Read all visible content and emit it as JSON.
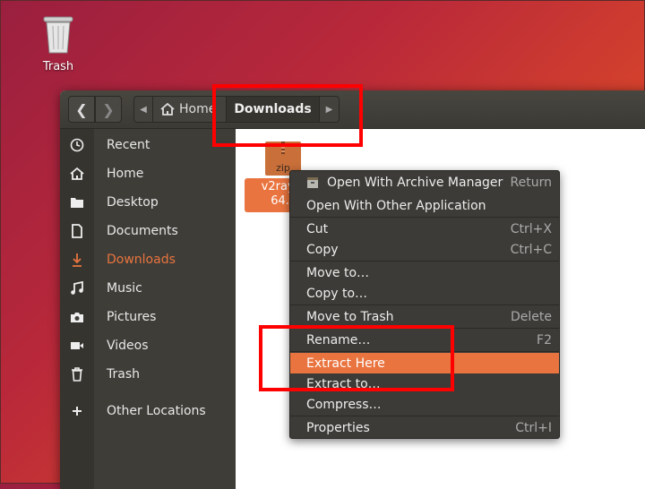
{
  "desktop": {
    "trash_label": "Trash"
  },
  "headerbar": {
    "home_label": "Home",
    "current_folder": "Downloads"
  },
  "sidebar": {
    "items": [
      {
        "label": "Recent",
        "icon": "clock-icon"
      },
      {
        "label": "Home",
        "icon": "home-icon"
      },
      {
        "label": "Desktop",
        "icon": "folder-icon"
      },
      {
        "label": "Documents",
        "icon": "document-icon"
      },
      {
        "label": "Downloads",
        "icon": "download-icon",
        "active": true
      },
      {
        "label": "Music",
        "icon": "music-icon"
      },
      {
        "label": "Pictures",
        "icon": "camera-icon"
      },
      {
        "label": "Videos",
        "icon": "video-icon"
      },
      {
        "label": "Trash",
        "icon": "trash-icon"
      },
      {
        "label": "Other Locations",
        "icon": "plus-icon"
      }
    ]
  },
  "file": {
    "type_label": "zip",
    "name_line1": "v2ray-li",
    "name_line2": "64.z"
  },
  "context_menu": {
    "items": [
      {
        "label": "Open With Archive Manager",
        "accel": "Return"
      },
      {
        "label": "Open With Other Application",
        "accel": ""
      },
      {
        "label": "Cut",
        "accel": "Ctrl+X"
      },
      {
        "label": "Copy",
        "accel": "Ctrl+C"
      },
      {
        "label": "Move to…",
        "accel": ""
      },
      {
        "label": "Copy to…",
        "accel": ""
      },
      {
        "label": "Move to Trash",
        "accel": "Delete"
      },
      {
        "label": "Rename…",
        "accel": "F2"
      },
      {
        "label": "Extract Here",
        "accel": "",
        "highlighted": true
      },
      {
        "label": "Extract to…",
        "accel": ""
      },
      {
        "label": "Compress…",
        "accel": ""
      },
      {
        "label": "Properties",
        "accel": "Ctrl+I"
      }
    ]
  },
  "colors": {
    "accent": "#e9743f",
    "annotation": "#ff0000"
  }
}
